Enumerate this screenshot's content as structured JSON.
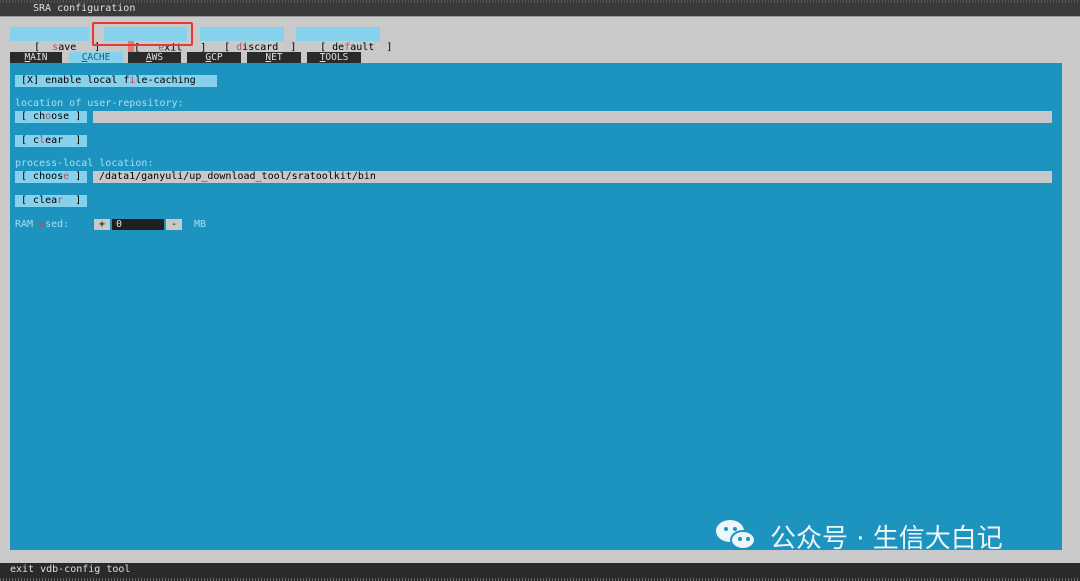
{
  "window": {
    "title": "SRA configuration"
  },
  "toolbar": {
    "save": {
      "pre": "[  ",
      "hot": "s",
      "post": "ave   ]"
    },
    "exit": {
      "pre": "[   ",
      "hot": "e",
      "post": "xit   ]"
    },
    "discard": {
      "pre": "[ ",
      "hot": "d",
      "post": "iscard  ]"
    },
    "default": {
      "pre": "[ de",
      "hot": "f",
      "post": "ault  ]"
    }
  },
  "tabs": [
    {
      "ul": "M",
      "rest": "AIN"
    },
    {
      "ul": "C",
      "rest": "ACHE"
    },
    {
      "ul": "A",
      "rest": "WS"
    },
    {
      "ul": "G",
      "rest": "CP"
    },
    {
      "ul": "N",
      "rest": "ET"
    },
    {
      "ul": "T",
      "rest": "OOLS"
    }
  ],
  "cache": {
    "enable_caching": {
      "pre": " [X] enable local f",
      "hot": "i",
      "post": "le-caching  "
    },
    "user_repo_label": "location of user-repository:",
    "choose1": {
      "pre": " [ ch",
      "hot": "o",
      "post": "ose ] "
    },
    "user_repo_value": "",
    "clear1": {
      "pre": " [ c",
      "hot": "l",
      "post": "ear  ] "
    },
    "process_local_label": "process-local location:",
    "choose2": {
      "pre": " [ choos",
      "hot": "e",
      "post": " ] "
    },
    "process_local_value": "/data1/ganyuli/up_download_tool/sratoolkit/bin",
    "clear2": {
      "pre": " [ clea",
      "hot": "r",
      "post": "  ] "
    },
    "ram_label_pre": "RAM ",
    "ram_label_hot": "u",
    "ram_label_post": "sed:",
    "ram_plus": "+",
    "ram_value": "0",
    "ram_minus": "-",
    "ram_unit": "MB"
  },
  "status": {
    "text": "exit vdb-config tool"
  },
  "watermark": {
    "text": "公众号 · 生信大白记",
    "icon": "wechat-icon"
  },
  "colors": {
    "panel": "#1d94c0",
    "button": "#86d2ec",
    "highlight": "#e53935"
  }
}
